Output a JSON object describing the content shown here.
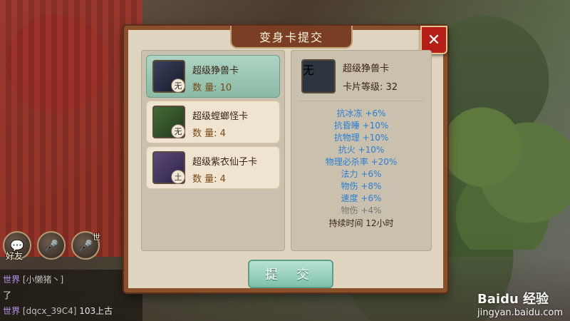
{
  "modal": {
    "title": "变身卡提交",
    "close_label": "✕",
    "submit_label": "提 交"
  },
  "cards": [
    {
      "name": "超级狰兽卡",
      "qty": "数 量: 10",
      "tag": "无"
    },
    {
      "name": "超级螳螂怪卡",
      "qty": "数 量: 4",
      "tag": "无"
    },
    {
      "name": "超级紫衣仙子卡",
      "qty": "数 量: 4",
      "tag": "土"
    }
  ],
  "details": {
    "name": "超级狰兽卡",
    "level": "卡片等级: 32",
    "tag": "无",
    "attributes": [
      {
        "text": "抗冰冻 +6%"
      },
      {
        "text": "抗昏睡 +10%"
      },
      {
        "text": "抗物理 +10%"
      },
      {
        "text": "抗火 +10%"
      },
      {
        "text": "物理必杀率 +20%"
      },
      {
        "text": "法力 +6%"
      },
      {
        "text": "物伤 +8%"
      },
      {
        "text": "速度 +6%"
      },
      {
        "text": "物伤 +4%"
      }
    ],
    "duration": "持续时间 12小时"
  },
  "hud": {
    "friend_label": "好友",
    "world_label": "世"
  },
  "chat": {
    "lines": [
      {
        "channel": "世界",
        "name": "[小懒猪丶]",
        "text": ""
      },
      {
        "channel": "",
        "name": "",
        "text": "了"
      },
      {
        "channel": "世界",
        "name": "[dqcx_39C4]",
        "text": "103上古"
      }
    ]
  },
  "watermark": {
    "top": "Baidu 经验",
    "bottom": "jingyan.baidu.com"
  },
  "colors": {
    "attribute_blue": "#2a7fd5",
    "selected_green": "#8bbaa7",
    "frame_brown": "#8a4f2b",
    "close_red": "#b51e16"
  }
}
